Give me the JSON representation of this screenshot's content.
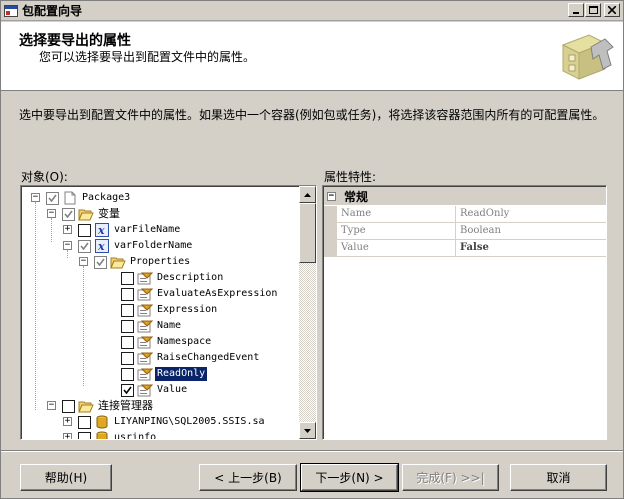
{
  "window": {
    "title": "包配置向导"
  },
  "header": {
    "title": "选择要导出的属性",
    "subtitle": "您可以选择要导出到配置文件中的属性。"
  },
  "instruction": "选中要导出到配置文件中的属性。如果选中一个容器(例如包或任务)，将选择该容器范围内所有的可配置属性。",
  "objects_label": "对象(O):",
  "properties_label": "属性特性:",
  "tree": {
    "package": "Package3",
    "variables": "变量",
    "var1": "varFileName",
    "var2": "varFolderName",
    "properties": "Properties",
    "props": [
      "Description",
      "EvaluateAsExpression",
      "Expression",
      "Name",
      "Namespace",
      "RaiseChangedEvent",
      "ReadOnly",
      "Value"
    ],
    "conn_mgr": "连接管理器",
    "conn1": "LIYANPING\\SQL2005.SSIS.sa",
    "conn2": "usrinfo"
  },
  "grid": {
    "category": "常规",
    "rows": [
      {
        "name": "Name",
        "value": "ReadOnly"
      },
      {
        "name": "Type",
        "value": "Boolean"
      },
      {
        "name": "Value",
        "value": "False"
      }
    ]
  },
  "buttons": {
    "help": "帮助(H)",
    "back": "< 上一步(B)",
    "next": "下一步(N) >",
    "finish": "完成(F) >>|",
    "cancel": "取消"
  }
}
